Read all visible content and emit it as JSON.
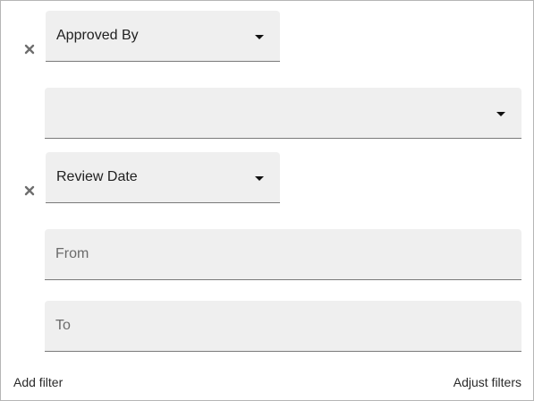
{
  "filters": [
    {
      "field_value": "Approved By",
      "value_dropdown": ""
    },
    {
      "field_value": "Review Date",
      "from_placeholder": "From",
      "to_placeholder": "To"
    }
  ],
  "footer": {
    "add_filter_label": "Add filter",
    "adjust_filters_label": "Adjust filters"
  },
  "icons": {
    "remove": "close-icon",
    "dropdown": "caret-down-icon"
  },
  "colors": {
    "field_background": "#efefef",
    "field_underline": "#7a7a7a",
    "placeholder_text": "#6b6b6b",
    "remove_icon": "#6e6e6e"
  }
}
